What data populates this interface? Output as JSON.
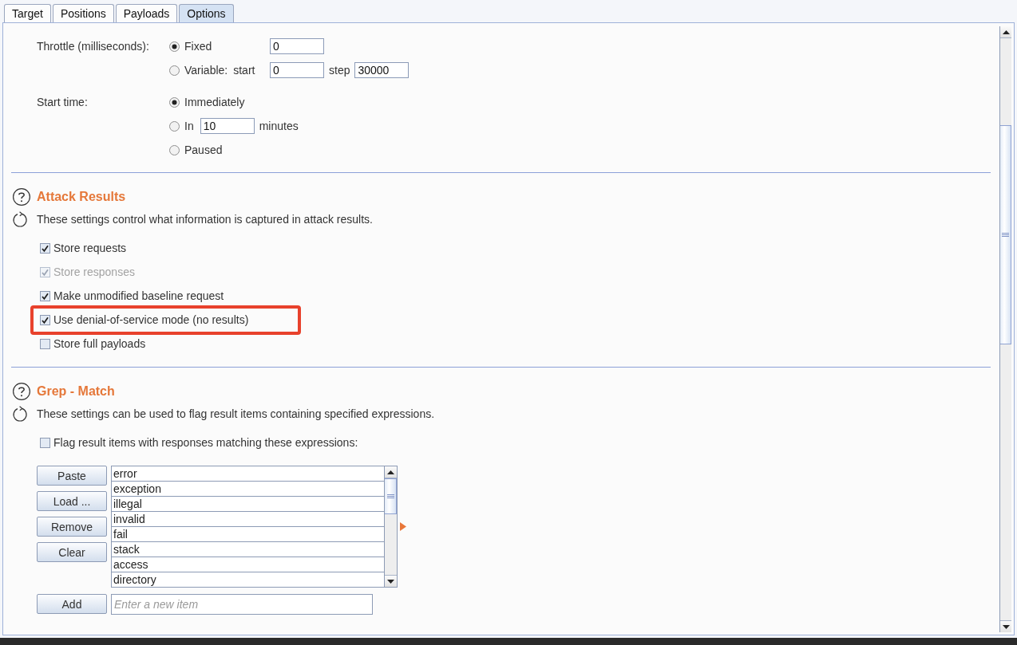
{
  "tabs": [
    {
      "label": "Target",
      "selected": false
    },
    {
      "label": "Positions",
      "selected": false
    },
    {
      "label": "Payloads",
      "selected": false
    },
    {
      "label": "Options",
      "selected": true
    }
  ],
  "settings_groups": [
    {
      "label": "Throttle (milliseconds):",
      "options": [
        {
          "kind": "fixed",
          "label": "Fixed",
          "selected": true,
          "value": "0"
        },
        {
          "kind": "variable",
          "label": "Variable:",
          "selected": false,
          "start_label": "start",
          "start_value": "0",
          "step_label": "step",
          "step_value": "30000"
        }
      ]
    },
    {
      "label": "Start time:",
      "options": [
        {
          "kind": "plain",
          "label": "Immediately",
          "selected": true
        },
        {
          "kind": "delay",
          "label": "In",
          "selected": false,
          "value": "10",
          "unit": "minutes"
        },
        {
          "kind": "plain",
          "label": "Paused",
          "selected": false
        }
      ]
    }
  ],
  "sections": [
    {
      "title": "Attack Results",
      "description": "These settings control what information is captured in attack results.",
      "checkboxes": [
        {
          "label": "Store requests",
          "checked": true,
          "disabled": false,
          "highlighted": false
        },
        {
          "label": "Store responses",
          "checked": true,
          "disabled": true,
          "highlighted": false
        },
        {
          "label": "Make unmodified baseline request",
          "checked": true,
          "disabled": false,
          "highlighted": false
        },
        {
          "label": "Use denial-of-service mode (no results)",
          "checked": true,
          "disabled": false,
          "highlighted": true
        },
        {
          "label": "Store full payloads",
          "checked": false,
          "disabled": false,
          "highlighted": false
        }
      ]
    },
    {
      "title": "Grep - Match",
      "description": "These settings can be used to flag result items containing specified expressions.",
      "checkboxes": [
        {
          "label": "Flag result items with responses matching these expressions:",
          "checked": false,
          "disabled": false,
          "highlighted": false
        }
      ],
      "list_editor": {
        "buttons": [
          "Paste",
          "Load ...",
          "Remove",
          "Clear"
        ],
        "items": [
          "error",
          "exception",
          "illegal",
          "invalid",
          "fail",
          "stack",
          "access",
          "directory"
        ],
        "add_button": "Add",
        "add_placeholder": "Enter a new item"
      }
    }
  ]
}
